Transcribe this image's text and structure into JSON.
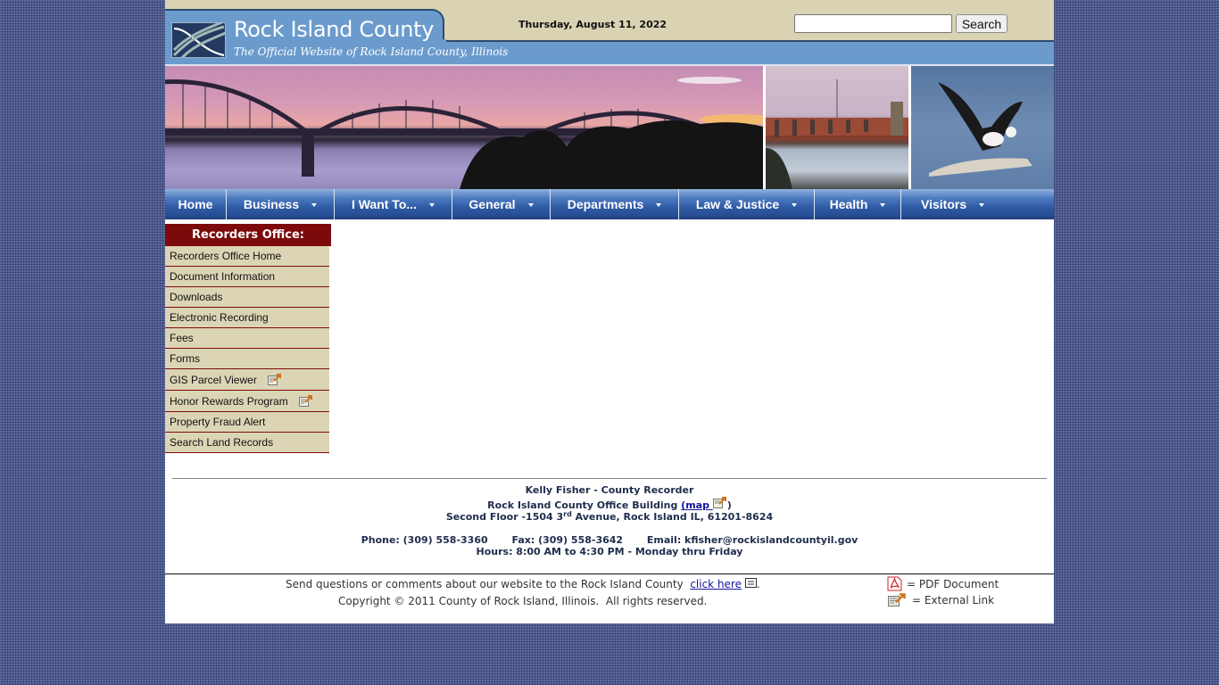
{
  "header": {
    "site_title": "Rock Island County",
    "site_subtitle": "The Official Website of Rock Island County, Illinois",
    "date": "Thursday, August 11, 2022",
    "search": {
      "value": "",
      "placeholder": "",
      "button_label": "Search"
    }
  },
  "banner": {
    "photos": [
      {
        "subject": "arch bridge over river at sunset"
      },
      {
        "subject": "lock and dam on river"
      },
      {
        "subject": "bald eagle on ice floe"
      }
    ]
  },
  "nav": {
    "items": [
      {
        "label": "Home",
        "has_dropdown": false
      },
      {
        "label": "Business",
        "has_dropdown": true
      },
      {
        "label": "I Want To...",
        "has_dropdown": true
      },
      {
        "label": "General",
        "has_dropdown": true
      },
      {
        "label": "Departments",
        "has_dropdown": true
      },
      {
        "label": "Law & Justice",
        "has_dropdown": true
      },
      {
        "label": "Health",
        "has_dropdown": true
      },
      {
        "label": "Visitors",
        "has_dropdown": true
      }
    ]
  },
  "sidebar": {
    "header": "Recorders Office:",
    "items": [
      {
        "label": "Recorders Office Home",
        "external": false
      },
      {
        "label": "Document Information",
        "external": false
      },
      {
        "label": "Downloads",
        "external": false
      },
      {
        "label": "Electronic Recording",
        "external": false
      },
      {
        "label": "Fees",
        "external": false
      },
      {
        "label": "Forms",
        "external": false
      },
      {
        "label": "GIS Parcel Viewer",
        "external": true
      },
      {
        "label": "Honor Rewards Program",
        "external": true
      },
      {
        "label": "Property Fraud Alert",
        "external": false
      },
      {
        "label": "Search Land Records",
        "external": false
      }
    ]
  },
  "contact": {
    "name_line": "Kelly Fisher - County Recorder",
    "building_prefix": "Rock Island County Office Building ",
    "map_link": "map",
    "address_prefix": "Second Floor -1504 3",
    "address_sup": "rd",
    "address_suffix": " Avenue, Rock Island IL, 61201-8624",
    "phone": "Phone: (309) 558-3360",
    "fax": "Fax: (309) 558-3642",
    "email": "Email: kfisher@rockislandcountyil.gov",
    "hours": "Hours: 8:00 AM to 4:30 PM - Monday thru Friday"
  },
  "footer": {
    "feedback_prefix": "Send questions or comments about our website to the Rock Island County  ",
    "feedback_link": "click here",
    "copyright": "Copyright © 2011 County of Rock Island, Illinois.  All rights reserved.",
    "legend": [
      {
        "icon": "pdf-icon",
        "label": "= PDF Document"
      },
      {
        "icon": "external-link-icon",
        "label": "= External Link"
      }
    ]
  },
  "colors": {
    "page_background": "#3f4a7d",
    "header_tan": "#d9d3b4",
    "header_blue": "#6b9bcd",
    "nav_blue": "#2f5ba5",
    "sidebar_maroon": "#7d0a0a",
    "sidebar_item_bg": "#dbd5b5",
    "link": "#1414a0"
  }
}
